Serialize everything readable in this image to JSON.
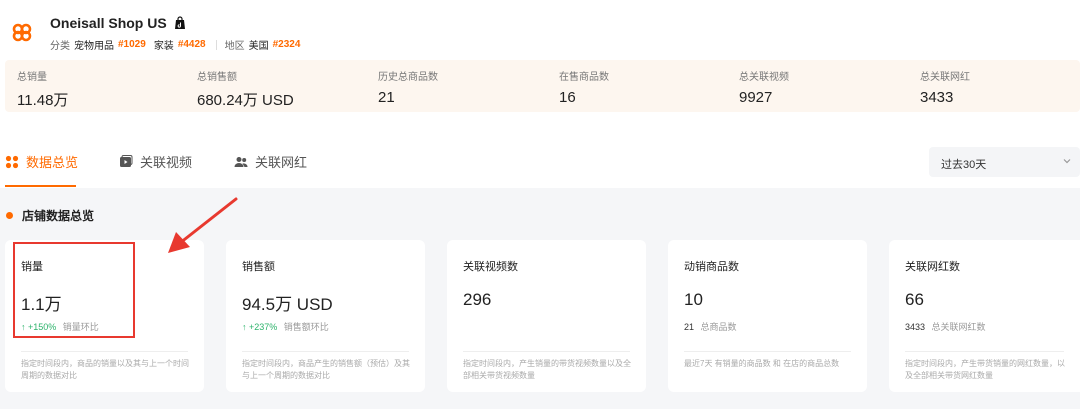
{
  "shop": {
    "name": "Oneisall Shop US",
    "category_label": "分类",
    "category_1": "宠物用品",
    "category_1_rank": "#1029",
    "category_2": "家装",
    "category_2_rank": "#4428",
    "region_label": "地区",
    "region": "美国",
    "region_rank": "#2324"
  },
  "summary": [
    {
      "label": "总销量",
      "value": "11.48万"
    },
    {
      "label": "总销售额",
      "value": "680.24万 USD"
    },
    {
      "label": "历史总商品数",
      "value": "21"
    },
    {
      "label": "在售商品数",
      "value": "16"
    },
    {
      "label": "总关联视频",
      "value": "9927"
    },
    {
      "label": "总关联网红",
      "value": "3433"
    }
  ],
  "tabs": [
    {
      "label": "数据总览",
      "icon": "grid-icon",
      "active": true
    },
    {
      "label": "关联视频",
      "icon": "video-icon",
      "active": false
    },
    {
      "label": "关联网红",
      "icon": "users-icon",
      "active": false
    }
  ],
  "period_select": {
    "value": "过去30天"
  },
  "section": {
    "title": "店铺数据总览"
  },
  "cards": [
    {
      "title": "销量",
      "value": "1.1万",
      "change": "↑ +150%",
      "change_label": "销量环比",
      "desc": "指定时间段内，商品的销量以及其与上一个时间周期的数据对比"
    },
    {
      "title": "销售额",
      "value": "94.5万 USD",
      "change": "↑ +237%",
      "change_label": "销售额环比",
      "desc": "指定时间段内，商品产生的销售额（预估）及其与上一个周期的数据对比"
    },
    {
      "title": "关联视频数",
      "value": "296",
      "desc": "指定时间段内，产生销量的带货视频数量以及全部相关带货视频数量"
    },
    {
      "title": "动销商品数",
      "value": "10",
      "sub_value": "21",
      "sub_label": "总商品数",
      "desc": "最近7天 有销量的商品数 和 在店的商品总数"
    },
    {
      "title": "关联网红数",
      "value": "66",
      "sub_value": "3433",
      "sub_label": "总关联网红数",
      "desc": "指定时间段内，产生带货销量的网红数量，以及全部相关带货网红数量"
    }
  ],
  "colors": {
    "accent": "#ff6a00",
    "positive": "#2db36b",
    "highlight": "#e8392f"
  }
}
